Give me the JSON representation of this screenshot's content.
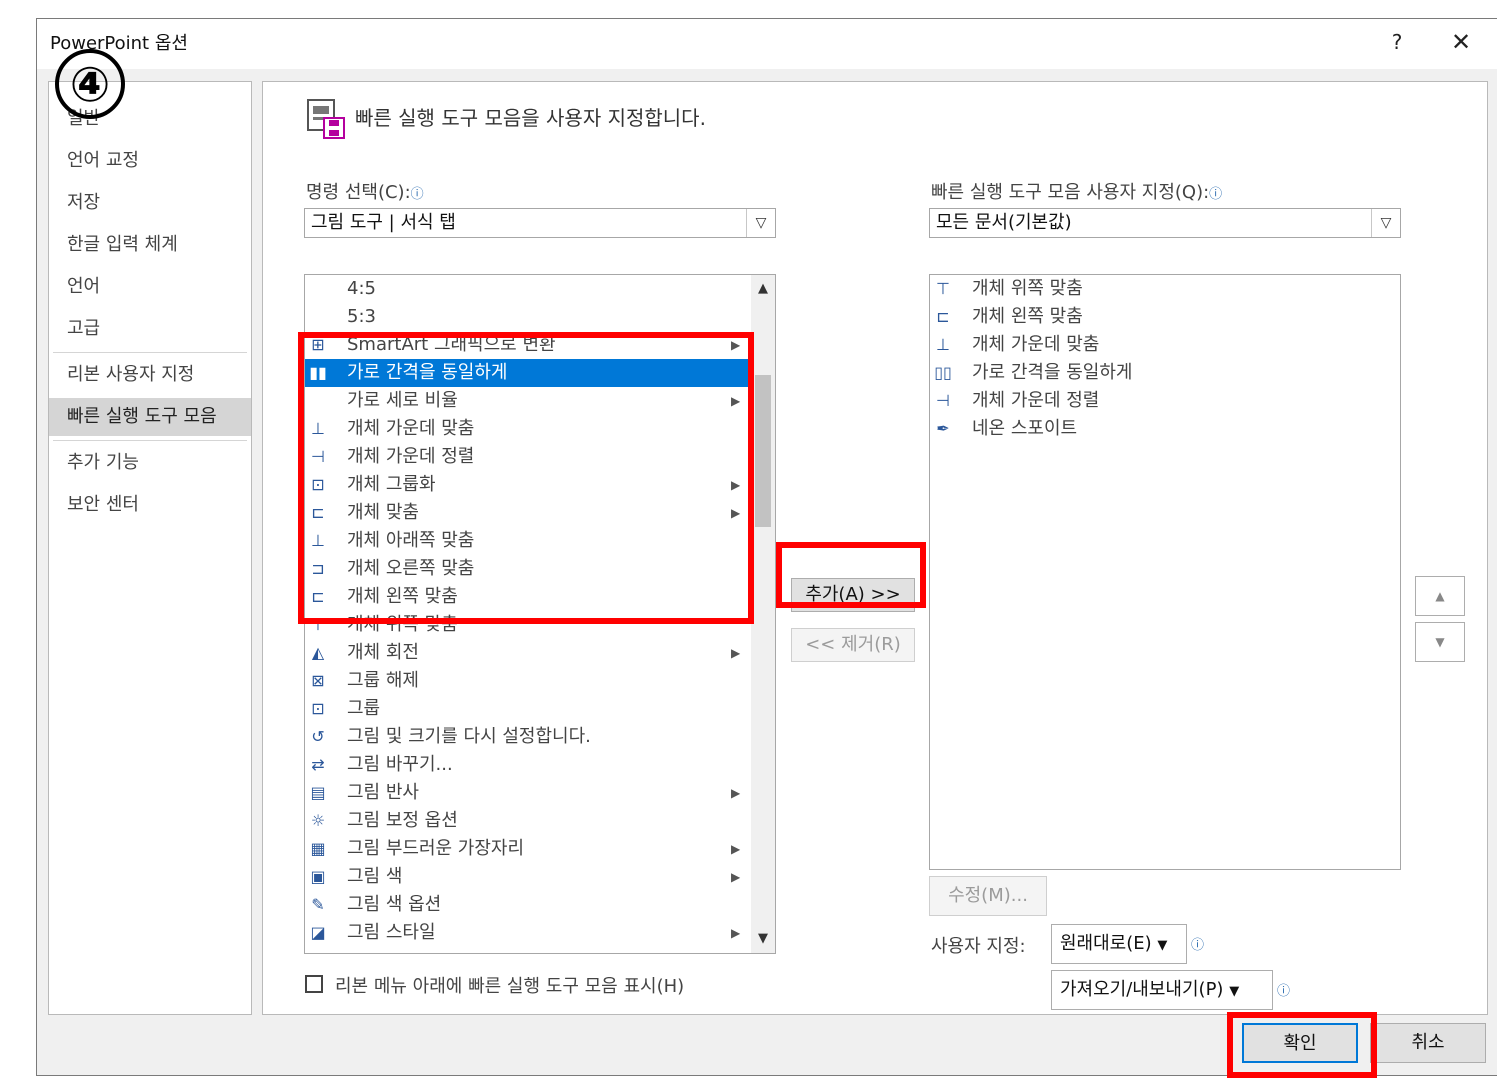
{
  "dialog": {
    "title": "PowerPoint 옵션",
    "help_glyph": "?",
    "close_glyph": "✕"
  },
  "annotation": {
    "step": "④"
  },
  "nav": {
    "items": [
      {
        "label": "일반"
      },
      {
        "label": "언어 교정"
      },
      {
        "label": "저장"
      },
      {
        "label": "한글 입력 체계"
      },
      {
        "label": "언어"
      },
      {
        "label": "고급"
      },
      {
        "label": "리본 사용자 지정"
      },
      {
        "label": "빠른 실행 도구 모음"
      },
      {
        "label": "추가 기능"
      },
      {
        "label": "보안 센터"
      }
    ],
    "selected": "빠른 실행 도구 모음"
  },
  "main": {
    "heading": "빠른 실행 도구 모음을 사용자 지정합니다.",
    "choose_label": "명령 선택(C):",
    "choose_value": "그림 도구 | 서식 탭",
    "customize_label": "빠른 실행 도구 모음 사용자 지정(Q):",
    "customize_value": "모든 문서(기본값)",
    "commands": [
      {
        "label": "4:5",
        "icon": "",
        "submenu": false
      },
      {
        "label": "5:3",
        "icon": "",
        "submenu": false
      },
      {
        "label": "SmartArt 그래픽으로 변환",
        "icon": "smartart-icon",
        "submenu": true
      },
      {
        "label": "가로 간격을 동일하게",
        "icon": "distribute-horizontal-icon",
        "submenu": false,
        "selected": true
      },
      {
        "label": "가로 세로 비율",
        "icon": "",
        "submenu": true
      },
      {
        "label": "개체 가운데 맞춤",
        "icon": "align-center-icon",
        "submenu": false
      },
      {
        "label": "개체 가운데 정렬",
        "icon": "align-middle-icon",
        "submenu": false
      },
      {
        "label": "개체 그룹화",
        "icon": "group-icon",
        "submenu": true
      },
      {
        "label": "개체 맞춤",
        "icon": "align-icon",
        "submenu": true
      },
      {
        "label": "개체 아래쪽 맞춤",
        "icon": "align-bottom-icon",
        "submenu": false
      },
      {
        "label": "개체 오른쪽 맞춤",
        "icon": "align-right-icon",
        "submenu": false
      },
      {
        "label": "개체 왼쪽 맞춤",
        "icon": "align-left-icon",
        "submenu": false
      },
      {
        "label": "개체 위쪽 맞춤",
        "icon": "align-top-icon",
        "submenu": false
      },
      {
        "label": "개체 회전",
        "icon": "rotate-icon",
        "submenu": true
      },
      {
        "label": "그룹 해제",
        "icon": "ungroup-icon",
        "submenu": false
      },
      {
        "label": "그룹",
        "icon": "group-icon",
        "submenu": false
      },
      {
        "label": "그림 및 크기를 다시 설정합니다.",
        "icon": "reset-picture-icon",
        "submenu": false
      },
      {
        "label": "그림 바꾸기...",
        "icon": "change-picture-icon",
        "submenu": false
      },
      {
        "label": "그림 반사",
        "icon": "reflection-icon",
        "submenu": true
      },
      {
        "label": "그림 보정 옵션",
        "icon": "corrections-icon",
        "submenu": false
      },
      {
        "label": "그림 부드러운 가장자리",
        "icon": "soft-edges-icon",
        "submenu": true
      },
      {
        "label": "그림 색",
        "icon": "picture-color-icon",
        "submenu": true
      },
      {
        "label": "그림 색 옵션",
        "icon": "color-options-icon",
        "submenu": false
      },
      {
        "label": "그림 스타일",
        "icon": "picture-style-icon",
        "submenu": true
      }
    ],
    "toolbar_items": [
      {
        "label": "개체 위쪽 맞춤",
        "icon": "align-top-icon"
      },
      {
        "label": "개체 왼쪽 맞춤",
        "icon": "align-left-icon"
      },
      {
        "label": "개체 가운데 맞춤",
        "icon": "align-center-icon"
      },
      {
        "label": "가로 간격을 동일하게",
        "icon": "distribute-horizontal-icon"
      },
      {
        "label": "개체 가운데 정렬",
        "icon": "align-middle-icon"
      },
      {
        "label": "네온 스포이트",
        "icon": "eyedropper-icon"
      }
    ],
    "add_button": "추가(A) >>",
    "remove_button": "<< 제거(R)",
    "modify_button": "수정(M)...",
    "customizations_label": "사용자 지정:",
    "reset_button": "원래대로(E)",
    "import_export_button": "가져오기/내보내기(P)",
    "show_below_ribbon": "리본 메뉴 아래에 빠른 실행 도구 모음 표시(H)"
  },
  "footer": {
    "ok_button": "확인",
    "cancel_button": "취소"
  },
  "colors": {
    "highlight": "#0078d7",
    "annotation_red": "#ff0000"
  }
}
